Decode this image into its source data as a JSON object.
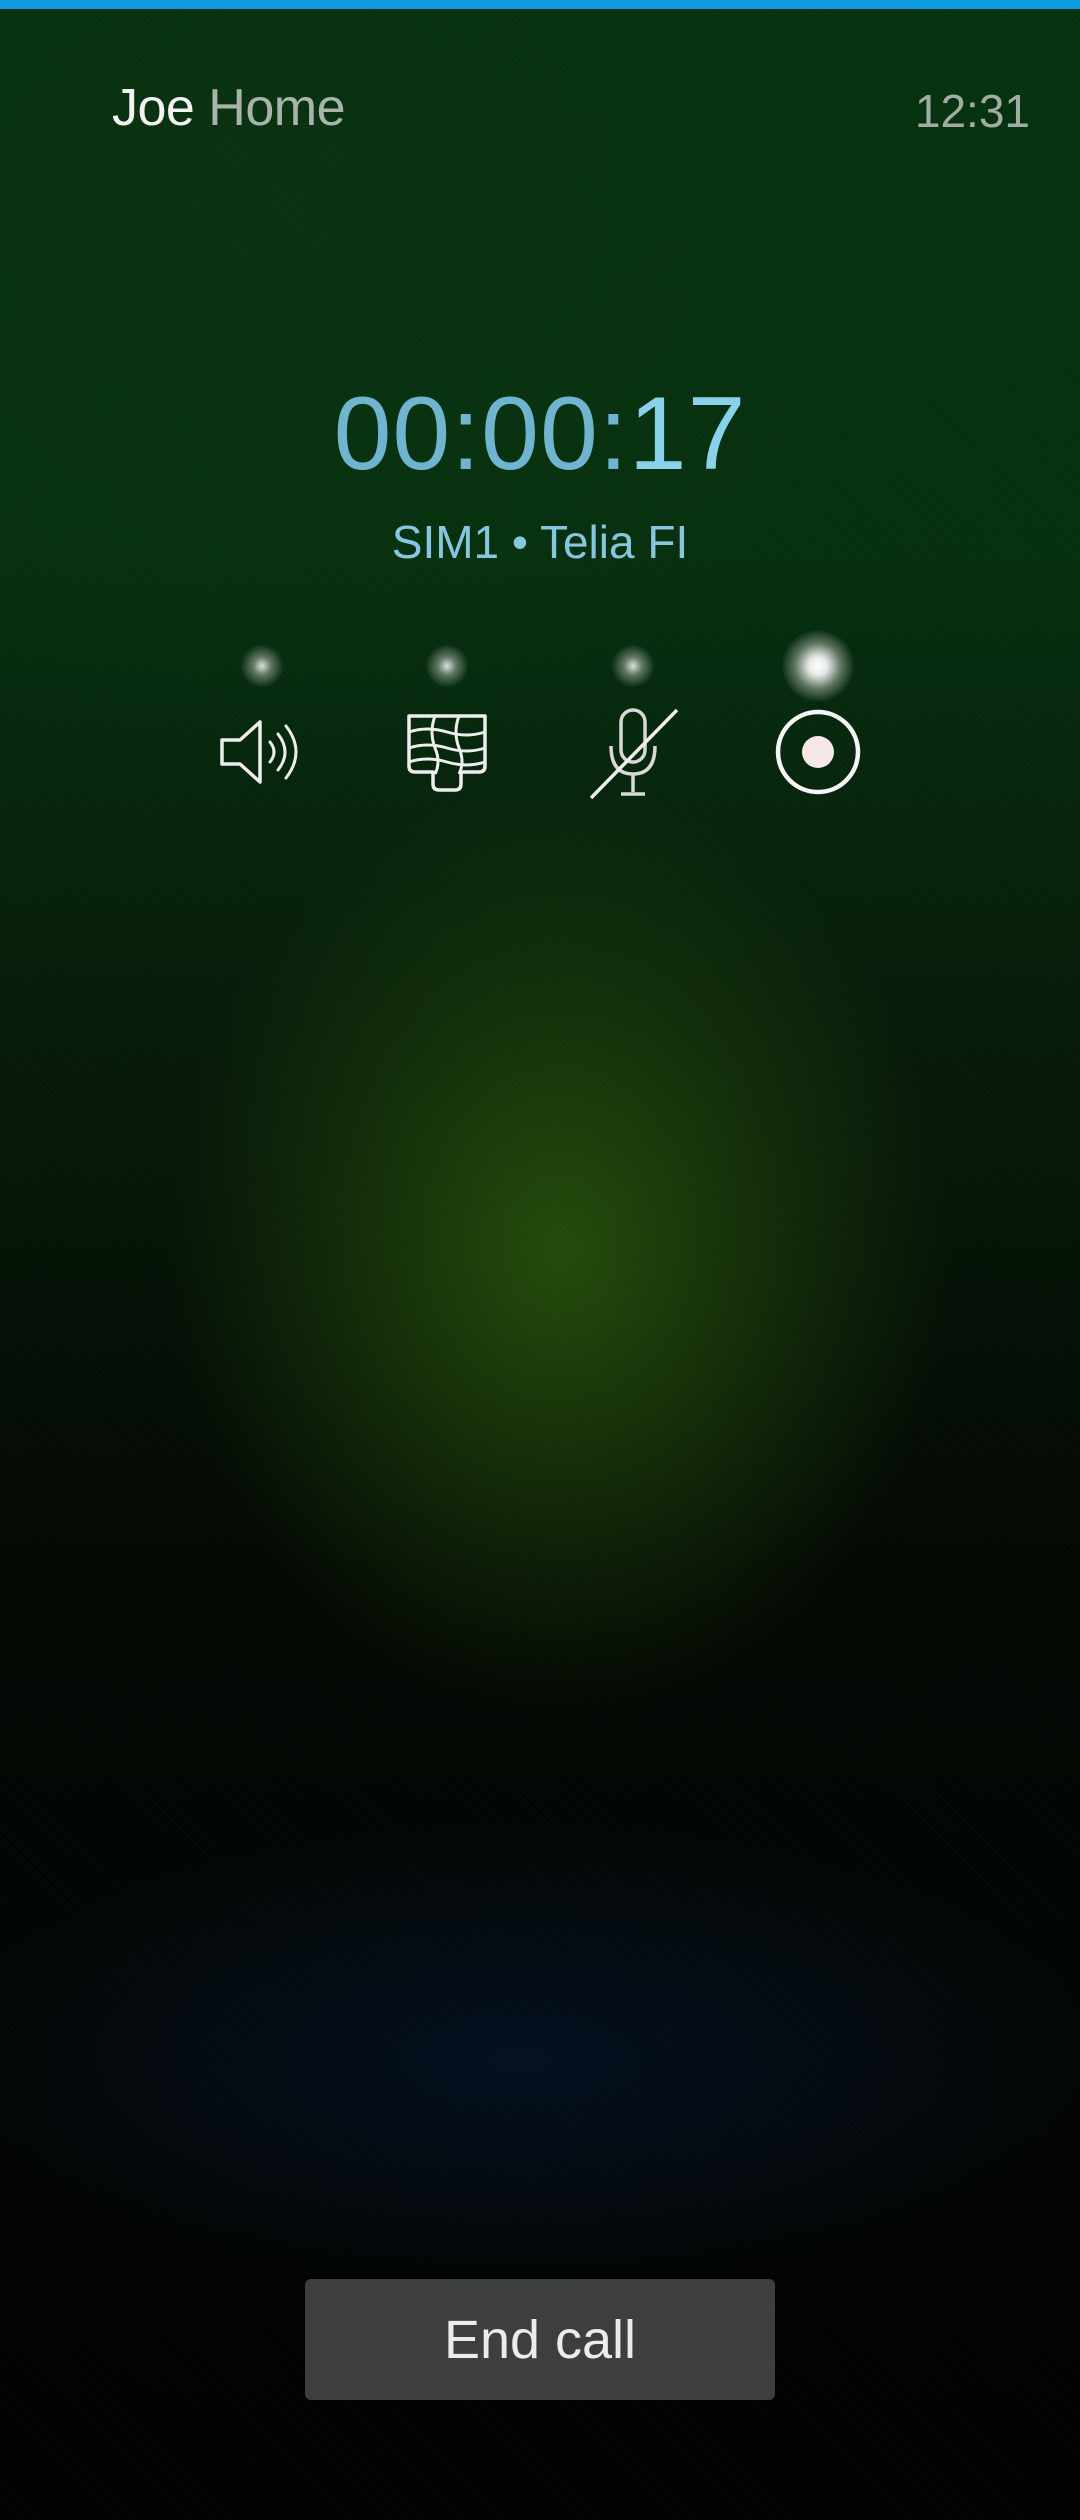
{
  "call": {
    "contact_name": "Joe",
    "number_type": "Home",
    "clock": "12:31",
    "timer_main": "00:00:",
    "timer_secs": "17",
    "sim_info": "SIM1 • Telia FI"
  },
  "controls": [
    {
      "icon": "speaker-icon",
      "active": false
    },
    {
      "icon": "keypad-icon",
      "active": false
    },
    {
      "icon": "mute-mic-icon",
      "active": false
    },
    {
      "icon": "record-icon",
      "active": true
    }
  ],
  "end_call_label": "End call",
  "colors": {
    "accent": "#0f9be0",
    "timer": "#6fb5d0",
    "background_green": "#06300f"
  }
}
